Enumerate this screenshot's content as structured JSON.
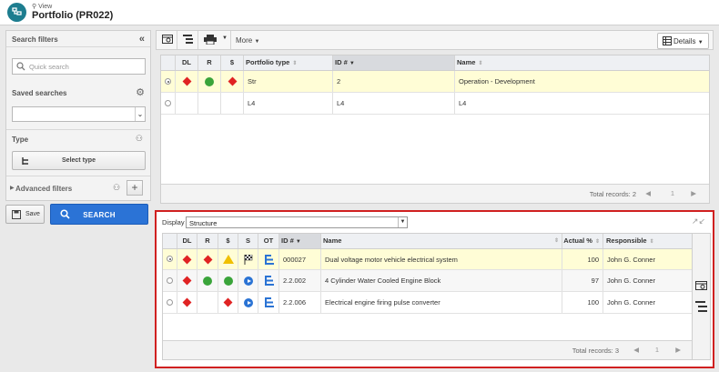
{
  "header": {
    "view_label": "View",
    "title": "Portfolio (PR022)"
  },
  "filters": {
    "title": "Search filters",
    "quick_search_placeholder": "Quick search",
    "saved_searches_label": "Saved searches",
    "saved_search_value": "",
    "type_label": "Type",
    "select_type_label": "Select type",
    "advanced_filters_label": "Advanced filters",
    "save_label": "Save",
    "search_label": "SEARCH"
  },
  "toolbar": {
    "more_label": "More",
    "details_label": "Details"
  },
  "top_grid": {
    "columns": [
      "DL",
      "R",
      "$",
      "Portfolio type",
      "ID #",
      "Name"
    ],
    "rows": [
      {
        "selected": true,
        "dl": "red-diamond",
        "r": "green-circle",
        "cost": "red-diamond",
        "type": "Str",
        "id": "2",
        "name": "Operation - Development"
      },
      {
        "selected": false,
        "dl": "",
        "r": "",
        "cost": "",
        "type": "L4",
        "id": "L4",
        "name": "L4"
      }
    ],
    "total_records": "Total records: 2",
    "page": "1"
  },
  "bottom": {
    "display_label": "Display",
    "display_value": "Structure",
    "columns": [
      "DL",
      "R",
      "$",
      "S",
      "OT",
      "ID #",
      "Name",
      "Actual %",
      "Responsible"
    ],
    "rows": [
      {
        "selected": true,
        "dl": "red-diamond",
        "r": "red-diamond",
        "cost": "yellow-triangle",
        "s": "checkered-flag-icon",
        "ot": "tree-structure-icon",
        "id": "000027",
        "name": "Dual voltage motor vehicle electrical system",
        "actual": "100",
        "responsible": "John G. Conner"
      },
      {
        "selected": false,
        "dl": "red-diamond",
        "r": "green-circle",
        "cost": "green-circle",
        "s": "blue-play-icon",
        "ot": "tree-structure-icon",
        "id": "2.2.002",
        "name": "4 Cylinder Water Cooled Engine Block",
        "actual": "97",
        "responsible": "John G. Conner"
      },
      {
        "selected": false,
        "dl": "red-diamond",
        "r": "",
        "cost": "red-diamond",
        "s": "blue-play-icon",
        "ot": "tree-structure-icon",
        "id": "2.2.006",
        "name": "Electrical engine firing pulse converter",
        "actual": "100",
        "responsible": "John G. Conner"
      }
    ],
    "total_records": "Total records: 3",
    "page": "1"
  },
  "colors": {
    "accent": "#2b73d6",
    "brand": "#1d7d8f",
    "highlight_border": "#d02020",
    "selected_row": "#fffdd6",
    "red": "#e02323",
    "green": "#3aa43a",
    "yellow": "#f0c000"
  }
}
